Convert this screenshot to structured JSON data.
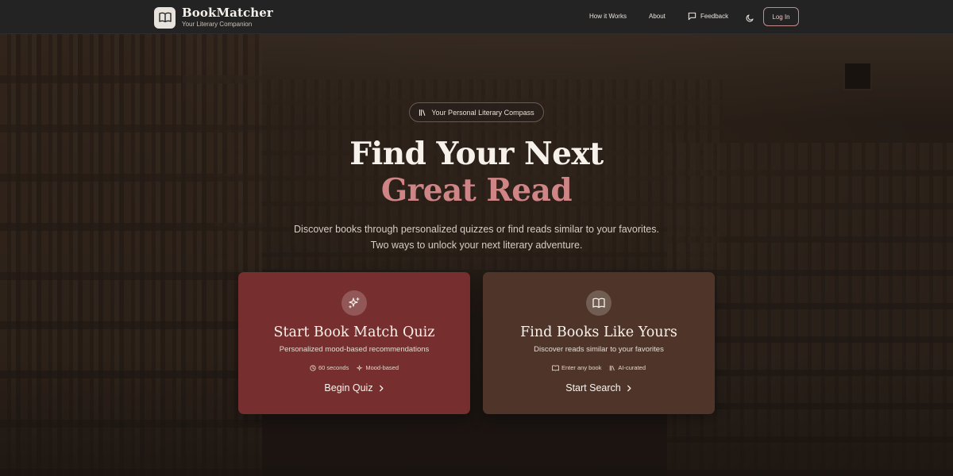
{
  "header": {
    "brand_name": "BookMatcher",
    "brand_tagline": "Your Literary Companion",
    "nav": {
      "how_it_works": "How it Works",
      "about": "About",
      "feedback": "Feedback",
      "login": "Log In"
    }
  },
  "hero": {
    "pill_label": "Your Personal Literary Compass",
    "title_line1": "Find Your Next",
    "title_line2": "Great Read",
    "subtitle_line1": "Discover books through personalized quizzes or find reads similar to your favorites.",
    "subtitle_line2": "Two ways to unlock your next literary adventure."
  },
  "cards": {
    "quiz": {
      "title": "Start Book Match Quiz",
      "description": "Personalized mood-based recommendations",
      "meta1": "60 seconds",
      "meta2": "Mood-based",
      "cta": "Begin Quiz"
    },
    "search": {
      "title": "Find Books Like Yours",
      "description": "Discover reads similar to your favorites",
      "meta1": "Enter any book",
      "meta2": "AI-curated",
      "cta": "Start Search"
    }
  },
  "icons": {
    "logo": "book-open-icon",
    "feedback": "message-square-icon",
    "theme": "moon-icon",
    "pill": "library-icon",
    "quiz": "sparkles-icon",
    "search": "book-open-icon",
    "clock": "clock-icon",
    "chevron": "chevron-right-icon"
  },
  "colors": {
    "header_bg": "#232323",
    "accent_rose": "#cf8585",
    "quiz_card": "#772e2e",
    "search_card": "#4f3529"
  }
}
